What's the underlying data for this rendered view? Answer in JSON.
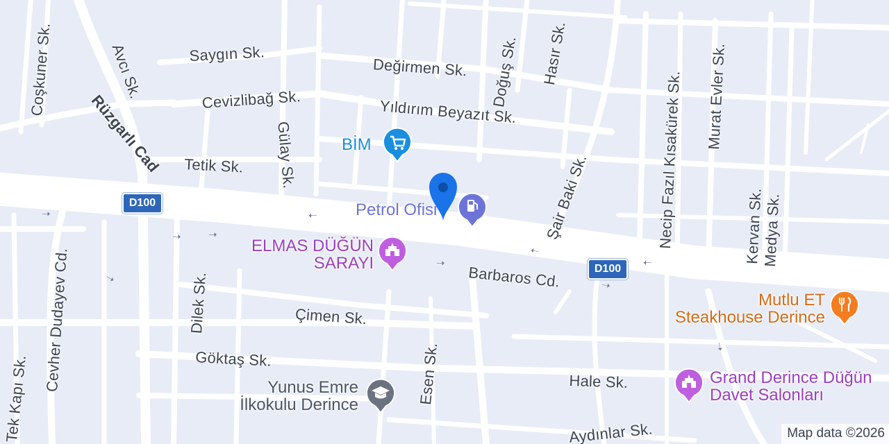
{
  "map": {
    "road_color": "#ffffff",
    "land_color": "#e8ecf7",
    "major_road_color": "#ffffff"
  },
  "streets": {
    "coskuner": "Coşkuner Sk.",
    "avci": "Avcı Sk.",
    "saygin": "Saygın Sk.",
    "degirmen": "Değirmen Sk.",
    "dogus": "Doğuş Sk.",
    "hasir": "Hasır Sk.",
    "necip": "Necip Fazıl Kısakürek Sk.",
    "murat": "Murat Evler Sk.",
    "ruzgarli": "Rüzgarlı Cad",
    "cevizlibag": "Cevizlibağ Sk.",
    "yildirim": "Yıldırım Beyazıt Sk.",
    "gulay": "Gülay Sk.",
    "tetik": "Tetik Sk.",
    "sairbaki": "Şair Baki Sk.",
    "kervan": "Kervan Sk.",
    "medya": "Medya Sk.",
    "cevher": "Cevher Dudayev Cd.",
    "dilek": "Dilek Sk.",
    "barbaros": "Barbaros Cd.",
    "cimen": "Çimen Sk.",
    "esen": "Esen Sk.",
    "goktas": "Göktaş Sk.",
    "hale": "Hale Sk.",
    "tekkapi": "Tek Kapı Sk.",
    "aydinlar": "Aydınlar Sk."
  },
  "highway_shields": [
    "D100",
    "D100"
  ],
  "pois": {
    "bim": {
      "name": "BİM",
      "icon": "shopping-cart-icon",
      "color": "#1a8fe0"
    },
    "petrol": {
      "name": "Petrol Ofisi",
      "icon": "gas-station-icon",
      "color": "#6d74d8"
    },
    "elmas": {
      "line1": "ELMAS DÜĞÜN",
      "line2": "SARAYI",
      "icon": "event-venue-icon",
      "color": "#bf5fe0"
    },
    "mutlu": {
      "line1": "Mutlu ET",
      "line2": "Steakhouse Derince",
      "icon": "fork-knife-icon",
      "color": "#f57c1f"
    },
    "grand": {
      "line1": "Grand Derince Düğün",
      "line2": "Davet Salonları",
      "icon": "event-venue-icon",
      "color": "#bf5fe0"
    },
    "yunus": {
      "line1": "Yunus Emre",
      "line2": "İlkokulu Derince",
      "icon": "graduation-cap-icon",
      "color": "#6b7280"
    }
  },
  "location_marker": {
    "icon": "location-pin-icon",
    "color": "#1a73e8"
  },
  "attribution": "Map data ©2026"
}
